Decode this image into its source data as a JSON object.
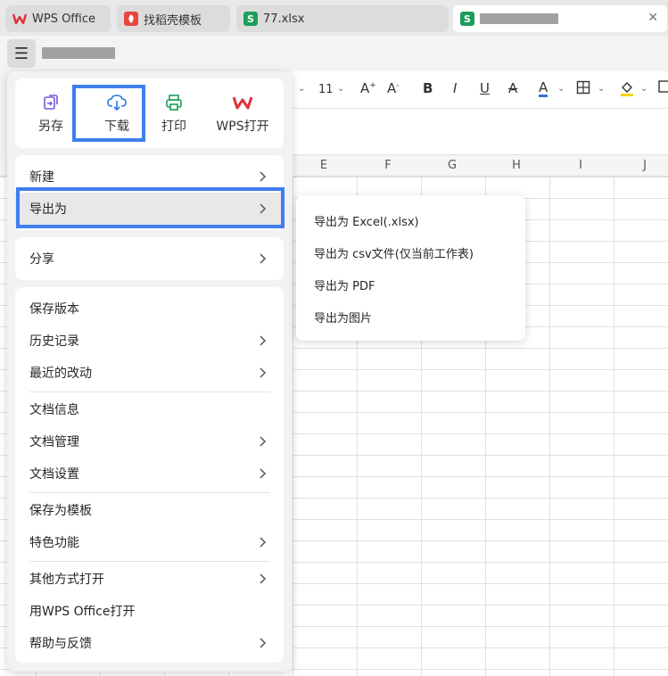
{
  "tabs": [
    {
      "label": "WPS Office",
      "icon": "wps-logo-icon"
    },
    {
      "label": "找稻壳模板",
      "icon": "docer-icon"
    },
    {
      "label": "77.xlsx",
      "icon": "sheet-icon",
      "badge": "S"
    },
    {
      "label": "",
      "icon": "sheet-icon",
      "badge": "S",
      "active": true
    }
  ],
  "ribbon": {
    "font_size": "11"
  },
  "columns": [
    "E",
    "F",
    "G",
    "H",
    "I",
    "J"
  ],
  "quick_actions": [
    {
      "label": "另存",
      "icon": "save-as-icon"
    },
    {
      "label": "下载",
      "icon": "download-icon",
      "highlighted": true
    },
    {
      "label": "打印",
      "icon": "print-icon"
    },
    {
      "label": "WPS打开",
      "icon": "wps-open-icon"
    }
  ],
  "menu": {
    "new": "新建",
    "export_as": "导出为",
    "share": "分享",
    "save_version": "保存版本",
    "history": "历史记录",
    "recent_changes": "最近的改动",
    "doc_info": "文档信息",
    "doc_manage": "文档管理",
    "doc_settings": "文档设置",
    "save_template": "保存为模板",
    "features": "特色功能",
    "open_other": "其他方式打开",
    "open_wps": "用WPS Office打开",
    "help": "帮助与反馈"
  },
  "export_submenu": [
    "导出为 Excel(.xlsx)",
    "导出为 csv文件(仅当前工作表)",
    "导出为 PDF",
    "导出为图片"
  ],
  "colors": {
    "highlight": "#3f7ef0",
    "wps_red": "#e0303a",
    "sheet_green": "#1c9d5b"
  }
}
